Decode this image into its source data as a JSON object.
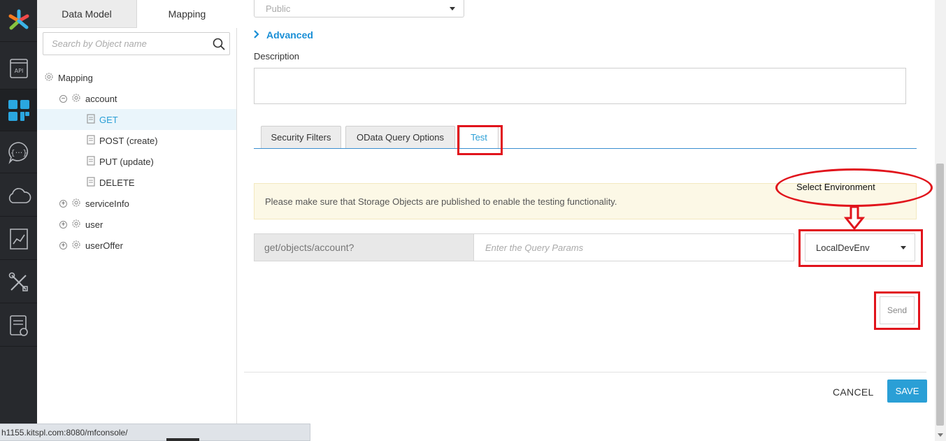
{
  "rail": {
    "items": [
      {
        "icon": "app-logo-icon"
      },
      {
        "icon": "api-icon"
      },
      {
        "icon": "objects-icon"
      },
      {
        "icon": "chat-braces-icon"
      },
      {
        "icon": "cloud-icon"
      },
      {
        "icon": "chart-doc-icon"
      },
      {
        "icon": "tools-icon"
      },
      {
        "icon": "report-icon"
      }
    ]
  },
  "left_panel": {
    "tabs": [
      {
        "label": "Data Model",
        "active": false
      },
      {
        "label": "Mapping",
        "active": true
      }
    ],
    "search": {
      "placeholder": "Search by Object name",
      "value": ""
    },
    "tree": {
      "root": "Mapping",
      "account": "account",
      "get": "GET",
      "post": "POST (create)",
      "put": "PUT (update)",
      "delete": "DELETE",
      "serviceinfo": "serviceInfo",
      "user": "user",
      "useroffer": "userOffer",
      "collapse_symbol": "−",
      "expand_symbol": "+"
    }
  },
  "main": {
    "visibility_select": {
      "value": "Public"
    },
    "advanced": "Advanced",
    "description_label": "Description",
    "tabs": [
      {
        "label": "Security Filters"
      },
      {
        "label": "OData Query Options"
      },
      {
        "label": "Test",
        "active": true
      }
    ],
    "notice": "Please make sure that Storage Objects are published to enable the testing functionality.",
    "url_prefix": "get/objects/account?",
    "query": {
      "placeholder": "Enter the Query Params",
      "value": ""
    },
    "environment": {
      "value": "LocalDevEnv"
    },
    "send_label": "Send",
    "cancel_label": "CANCEL",
    "save_label": "SAVE"
  },
  "annotation": {
    "label": "Select Environment",
    "color": "#e1141c"
  },
  "status_bar": {
    "url": "h1155.kitspl.com:8080/mfconsole/"
  },
  "colors": {
    "accent": "#2a9fd6",
    "rail_bg": "#27292d",
    "notice_bg": "#fcf8e6"
  }
}
